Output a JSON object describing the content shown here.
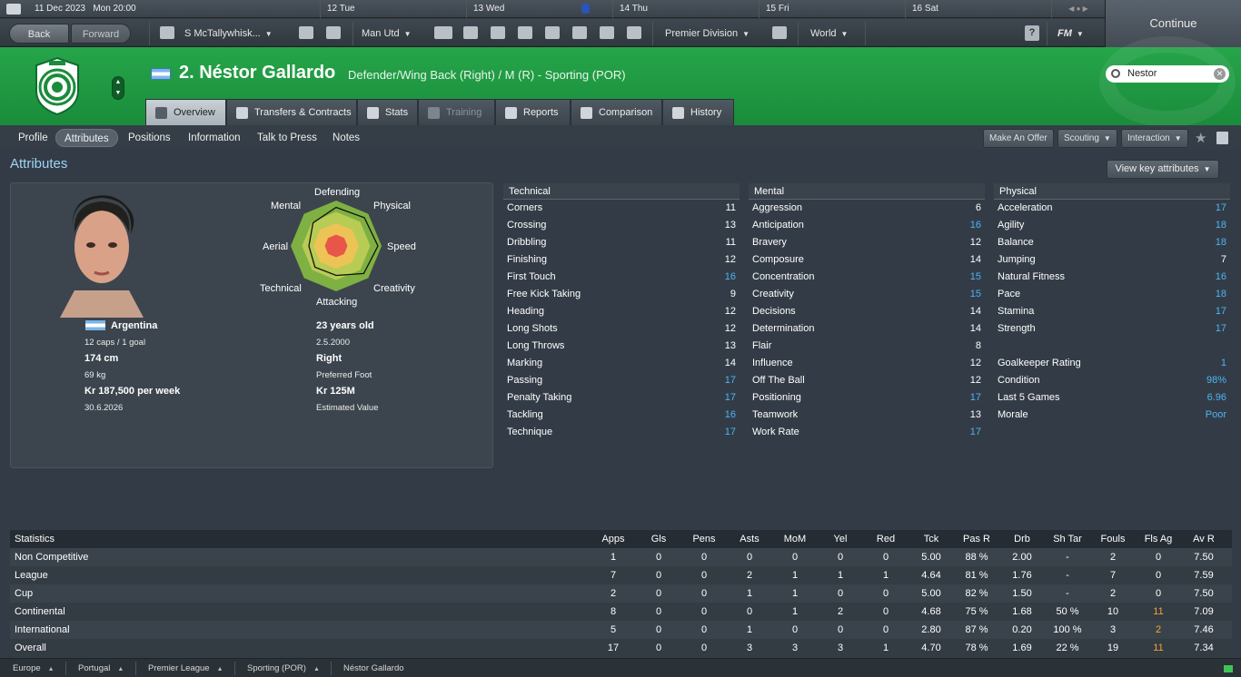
{
  "datebar": {
    "date": "11 Dec 2023",
    "time": "Mon 20:00",
    "days": [
      "12 Tue",
      "13 Wed",
      "14 Thu",
      "15 Fri",
      "16 Sat"
    ]
  },
  "toolbar": {
    "back": "Back",
    "forward": "Forward",
    "manager": "S McTallywhisk...",
    "club": "Man Utd",
    "league": "Premier Division",
    "world": "World",
    "help": "?",
    "fm": "FM"
  },
  "continue": "Continue",
  "player": {
    "name": "2. Néstor Gallardo",
    "position": "Defender/Wing Back (Right) / M (R) - Sporting (POR)"
  },
  "search": {
    "value": "Nestor"
  },
  "tabs": [
    "Overview",
    "Transfers & Contracts",
    "Stats",
    "Training",
    "Reports",
    "Comparison",
    "History"
  ],
  "subnav": [
    "Profile",
    "Attributes",
    "Positions",
    "Information",
    "Talk to Press",
    "Notes"
  ],
  "actions": {
    "offer": "Make An Offer",
    "scouting": "Scouting",
    "interaction": "Interaction"
  },
  "section_title": "Attributes",
  "key_button": "View key attributes",
  "radar": {
    "labels": {
      "top": "Defending",
      "tl": "Mental",
      "tr": "Physical",
      "l": "Aerial",
      "r": "Speed",
      "bl": "Technical",
      "br": "Creativity",
      "bottom": "Attacking"
    },
    "values": {
      "defending": 0.85,
      "physical": 0.88,
      "speed": 0.92,
      "creativity": 0.86,
      "attacking": 0.65,
      "technical": 0.66,
      "aerial": 0.6,
      "mental": 0.72
    }
  },
  "info": {
    "nation": "Argentina",
    "caps": "12 caps / 1 goal",
    "height": "174 cm",
    "weight": "69 kg",
    "wage": "Kr 187,500 per week",
    "contract": "30.6.2026",
    "age": "23 years old",
    "dob": "2.5.2000",
    "foot": "Right",
    "foot_label": "Preferred Foot",
    "value": "Kr 125M",
    "value_label": "Estimated Value"
  },
  "technical": {
    "title": "Technical",
    "rows": [
      [
        "Corners",
        "11"
      ],
      [
        "Crossing",
        "13"
      ],
      [
        "Dribbling",
        "11"
      ],
      [
        "Finishing",
        "12"
      ],
      [
        "First Touch",
        "16"
      ],
      [
        "Free Kick Taking",
        "9"
      ],
      [
        "Heading",
        "12"
      ],
      [
        "Long Shots",
        "12"
      ],
      [
        "Long Throws",
        "13"
      ],
      [
        "Marking",
        "14"
      ],
      [
        "Passing",
        "17"
      ],
      [
        "Penalty Taking",
        "17"
      ],
      [
        "Tackling",
        "16"
      ],
      [
        "Technique",
        "17"
      ]
    ]
  },
  "mental": {
    "title": "Mental",
    "rows": [
      [
        "Aggression",
        "6"
      ],
      [
        "Anticipation",
        "16"
      ],
      [
        "Bravery",
        "12"
      ],
      [
        "Composure",
        "14"
      ],
      [
        "Concentration",
        "15"
      ],
      [
        "Creativity",
        "15"
      ],
      [
        "Decisions",
        "14"
      ],
      [
        "Determination",
        "14"
      ],
      [
        "Flair",
        "8"
      ],
      [
        "Influence",
        "12"
      ],
      [
        "Off The Ball",
        "12"
      ],
      [
        "Positioning",
        "17"
      ],
      [
        "Teamwork",
        "13"
      ],
      [
        "Work Rate",
        "17"
      ]
    ]
  },
  "physical": {
    "title": "Physical",
    "rows": [
      [
        "Acceleration",
        "17"
      ],
      [
        "Agility",
        "18"
      ],
      [
        "Balance",
        "18"
      ],
      [
        "Jumping",
        "7"
      ],
      [
        "Natural Fitness",
        "16"
      ],
      [
        "Pace",
        "18"
      ],
      [
        "Stamina",
        "17"
      ],
      [
        "Strength",
        "17"
      ]
    ],
    "extra": [
      [
        "Goalkeeper Rating",
        "1"
      ],
      [
        "Condition",
        "98%"
      ],
      [
        "Last 5 Games",
        "6.96"
      ],
      [
        "Morale",
        "Poor"
      ]
    ]
  },
  "stats": {
    "headers": [
      "Statistics",
      "Apps",
      "Gls",
      "Pens",
      "Asts",
      "MoM",
      "Yel",
      "Red",
      "Tck",
      "Pas R",
      "Drb",
      "Sh Tar",
      "Fouls",
      "Fls Ag",
      "Av R"
    ],
    "rows": [
      [
        "Non Competitive",
        "1",
        "0",
        "0",
        "0",
        "0",
        "0",
        "0",
        "5.00",
        "88 %",
        "2.00",
        "-",
        "2",
        "0",
        "7.50"
      ],
      [
        "League",
        "7",
        "0",
        "0",
        "2",
        "1",
        "1",
        "1",
        "4.64",
        "81 %",
        "1.76",
        "-",
        "7",
        "0",
        "7.59"
      ],
      [
        "Cup",
        "2",
        "0",
        "0",
        "1",
        "1",
        "0",
        "0",
        "5.00",
        "82 %",
        "1.50",
        "-",
        "2",
        "0",
        "7.50"
      ],
      [
        "Continental",
        "8",
        "0",
        "0",
        "0",
        "1",
        "2",
        "0",
        "4.68",
        "75 %",
        "1.68",
        "50 %",
        "10",
        "11",
        "7.09"
      ],
      [
        "International",
        "5",
        "0",
        "0",
        "1",
        "0",
        "0",
        "0",
        "2.80",
        "87 %",
        "0.20",
        "100 %",
        "3",
        "2",
        "7.46"
      ],
      [
        "Overall",
        "17",
        "0",
        "0",
        "3",
        "3",
        "3",
        "1",
        "4.70",
        "78 %",
        "1.69",
        "22 %",
        "19",
        "11",
        "7.34"
      ]
    ]
  },
  "footer": [
    "Europe",
    "Portugal",
    "Premier League",
    "Sporting (POR)",
    "Néstor Gallardo"
  ]
}
